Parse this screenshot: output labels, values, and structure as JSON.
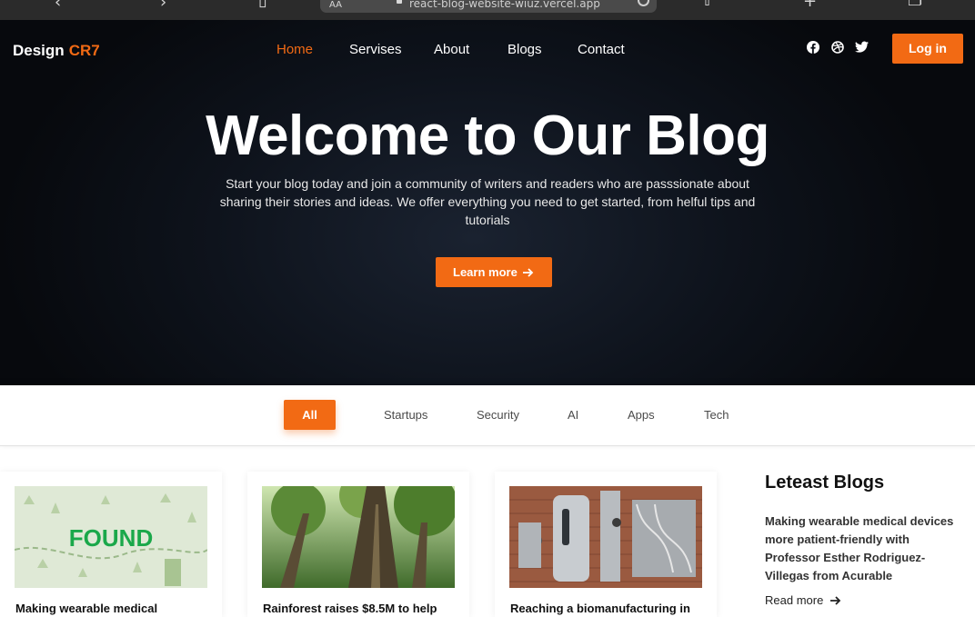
{
  "browser": {
    "aa_label": "AA",
    "url": "react-blog-website-wiuz.vercel.app"
  },
  "header": {
    "logo_main": "Design",
    "logo_accent": "CR7",
    "nav": [
      "Home",
      "Servises",
      "About",
      "Blogs",
      "Contact"
    ],
    "active_nav": "Home",
    "social_icons": [
      "facebook-icon",
      "dribbble-icon",
      "twitter-icon"
    ],
    "login_label": "Log in"
  },
  "hero": {
    "title": "Welcome to Our Blog",
    "subtitle": "Start your blog today and join a community of writers and readers who are passsionate about sharing their stories and ideas. We offer everything you need to get started, from helful tips and tutorials",
    "cta_label": "Learn more"
  },
  "filters": {
    "items": [
      "All",
      "Startups",
      "Security",
      "AI",
      "Apps",
      "Tech"
    ],
    "active": "All"
  },
  "cards": [
    {
      "title": "Making wearable medical",
      "image": "found-illustration",
      "image_text": "FOUND"
    },
    {
      "title": "Rainforest raises $8.5M to help",
      "image": "forest-photo"
    },
    {
      "title": "Reaching a biomanufacturing in",
      "image": "bioreactor-photo"
    }
  ],
  "sidebar": {
    "heading": "Leteast Blogs",
    "item_title": "Making wearable medical devices more patient-friendly with Professor Esther Rodriguez-Villegas from Acurable",
    "read_more": "Read more"
  },
  "colors": {
    "accent": "#f26a14",
    "hero_bg": "#0b0f16"
  }
}
